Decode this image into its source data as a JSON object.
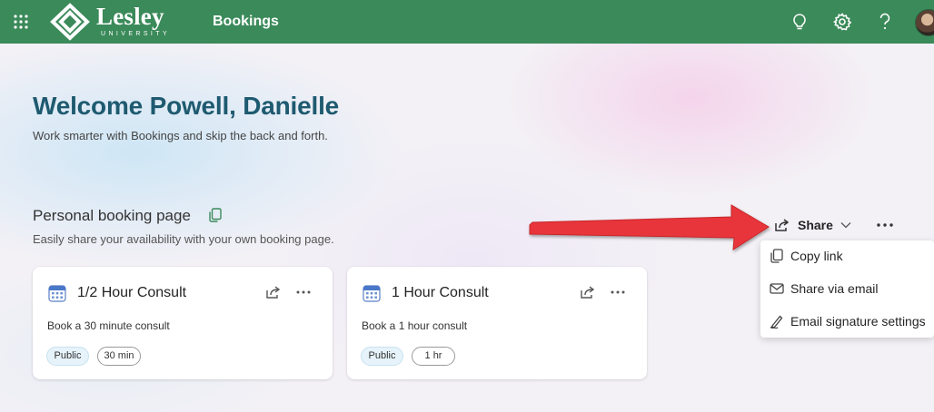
{
  "header": {
    "logo_word": "Lesley",
    "logo_sub": "UNIVERSITY",
    "app_title": "Bookings",
    "icons": [
      "waffle-icon",
      "lightbulb-icon",
      "gear-icon",
      "help-icon",
      "avatar"
    ],
    "brand_color": "#3b8a5a"
  },
  "main": {
    "welcome": "Welcome Powell, Danielle",
    "subtitle": "Work smarter with Bookings and skip the back and forth.",
    "section_title": "Personal booking page",
    "section_sub": "Easily share your availability with your own booking page.",
    "share_label": "Share",
    "share_menu": [
      {
        "label": "Copy link",
        "icon": "copy-icon"
      },
      {
        "label": "Share via email",
        "icon": "mail-icon"
      },
      {
        "label": "Email signature settings",
        "icon": "signature-pen-icon"
      }
    ],
    "cards": [
      {
        "title": "1/2 Hour Consult",
        "description": "Book a 30 minute consult",
        "visibility": "Public",
        "duration": "30 min"
      },
      {
        "title": "1 Hour Consult",
        "description": "Book a 1 hour consult",
        "visibility": "Public",
        "duration": "1 hr"
      }
    ]
  },
  "colors": {
    "welcome_text": "#1e5a70",
    "annotation_arrow": "#e8363a"
  }
}
